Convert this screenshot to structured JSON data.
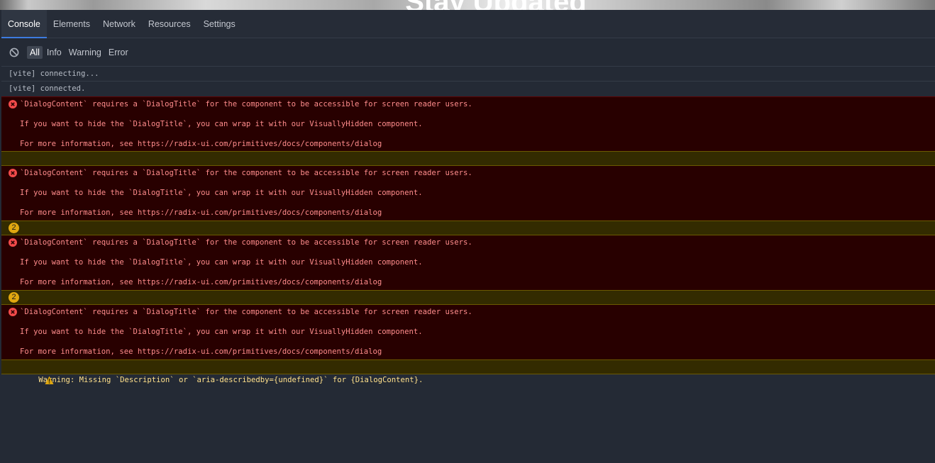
{
  "background": {
    "heading": "Stay Updated"
  },
  "tabs": [
    {
      "label": "Console",
      "active": true
    },
    {
      "label": "Elements"
    },
    {
      "label": "Network"
    },
    {
      "label": "Resources"
    },
    {
      "label": "Settings"
    }
  ],
  "filters": {
    "clear_icon": "clear-console-icon",
    "all": "All",
    "info": "Info",
    "warning": "Warning",
    "error": "Error",
    "active": "All"
  },
  "log": {
    "plain": [
      "[vite] connecting...",
      "[vite] connected."
    ],
    "error_lines": [
      "`DialogContent` requires a `DialogTitle` for the component to be accessible for screen reader users.",
      "If you want to hide the `DialogTitle`, you can wrap it with our VisuallyHidden component.",
      "For more information, see https://radix-ui.com/primitives/docs/components/dialog"
    ],
    "warning_text": "Warning: Missing `Description` or `aria-describedby={undefined}` for {DialogContent}.",
    "warning_count": "2"
  },
  "colors": {
    "panel_bg": "#242a35",
    "error_bg": "#280000",
    "error_text": "#ff8c8c",
    "warning_bg": "#332b00",
    "warning_text": "#ffe08a",
    "accent": "#3d7be0"
  }
}
